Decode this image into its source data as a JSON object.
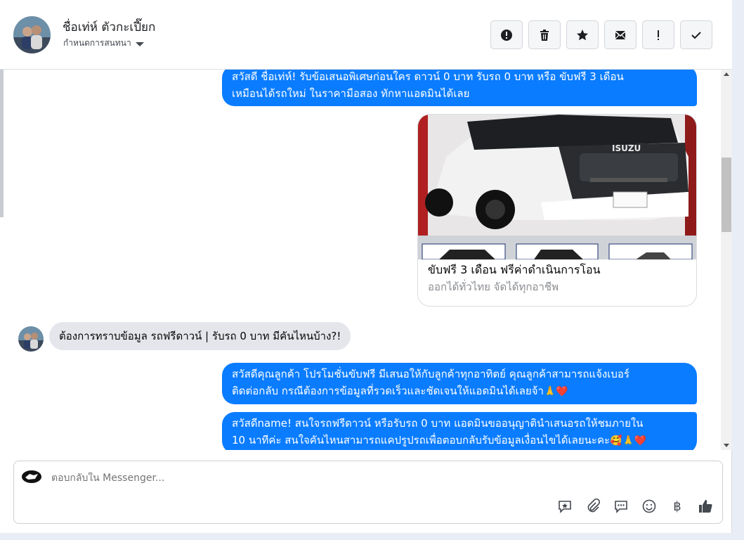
{
  "header": {
    "contact_name": "ชื่อเท่ห์ ตัวกะเปี๊ยก",
    "assign_label": "กำหนดการสนทนา",
    "actions": [
      "report-icon",
      "trash-icon",
      "star-icon",
      "mark-unread-icon",
      "spam-icon",
      "done-icon"
    ]
  },
  "messages": {
    "m1_line1": "สวัสดี ชื่อเท่ห์! รับข้อเสนอพิเศษก่อนใคร ดาวน์ 0 บาท รับรถ 0 บาท หรือ ขับฟรี 3 เดือน",
    "m1_line2": "เหมือนได้รถใหม่ ในราคามือสอง ทักหาแอดมินได้เลย",
    "card_title": "ขับฟรี 3 เดือน ฟรีค่าดำเนินการโอน",
    "card_subtitle": "ออกได้ทั่วไทย จัดได้ทุกอาชีพ",
    "card_brand": "ISUZU",
    "incoming": "ต้องการทราบข้อมูล รถฟรีดาวน์ | รับรถ 0 บาท มีคันไหนบ้าง?!",
    "m3_line1": "สวัสดีคุณลูกค้า โปรโมชั่นขับฟรี มีเสนอให้กับลูกค้าทุกอาทิตย์ คุณลูกค้าสามารถแจ้งเบอร์",
    "m3_line2": "ติดต่อกลับ กรณีต้องการข้อมูลที่รวดเร็วและชัดเจนให้แอดมินได้เลยจ้า",
    "m3_emoji": "🙏❤️",
    "m4_line1": "สวัสดีname! สนใจรถฟรีดาวน์ หรือรับรถ 0 บาท แอดมินขออนุญาตินำเสนอรถให้ชมภายใน",
    "m4_line2": "10 นาทีค่ะ สนใจคันไหนสามารถแคปรูปรถเพื่อตอบกลับรับข้อมูลเงื่อนไขได้เลยนะคะ",
    "m4_emoji": "🥰🙏❤️"
  },
  "composer": {
    "placeholder": "ตอบกลับใน Messenger...",
    "tools": [
      "saved-reply-icon",
      "attachment-icon",
      "quick-reply-icon",
      "emoji-icon",
      "baht-icon",
      "like-icon"
    ],
    "baht_symbol": "฿"
  },
  "colors": {
    "outgoing_bubble": "#0a7cff",
    "incoming_bubble": "#e4e6eb"
  }
}
